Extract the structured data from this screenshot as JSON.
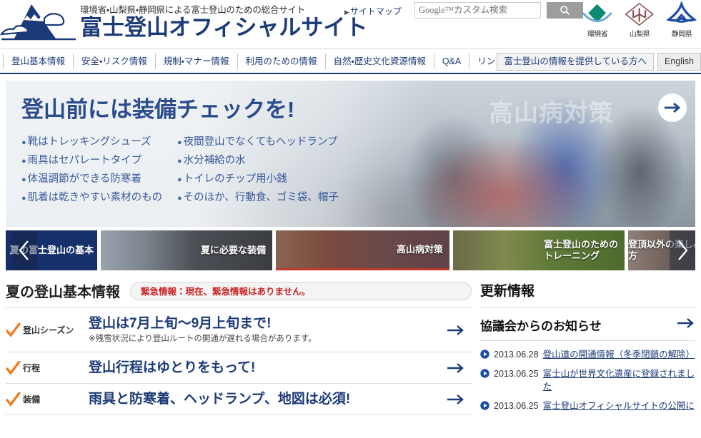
{
  "header": {
    "logo_sub": "環境省・山梨県・静岡県による富士登山のための総合サイト",
    "logo_main": "富士登山オフィシャルサイト",
    "logo_icon": "fuji-mountain-logo",
    "sitemap_label": "サイトマップ",
    "search": {
      "placeholder": "Google™カスタム検索",
      "value": "",
      "button_icon": "search-icon"
    },
    "agencies": [
      {
        "name": "環境省",
        "icon": "ministry-of-environment-logo",
        "color": "#0e8a72"
      },
      {
        "name": "山梨県",
        "icon": "yamanashi-prefecture-logo",
        "color": "#8a4a4a"
      },
      {
        "name": "静岡県",
        "icon": "shizuoka-prefecture-logo",
        "color": "#1b4ea8"
      }
    ]
  },
  "nav": {
    "items": [
      {
        "label": "登山基本情報"
      },
      {
        "label": "安全・リスク情報"
      },
      {
        "label": "規制・マナー情報"
      },
      {
        "label": "利用のための情報"
      },
      {
        "label": "自然・歴史文化資源情報"
      },
      {
        "label": "Q&A"
      },
      {
        "label": "リンク集"
      }
    ],
    "provider_button": "富士登山の情報を提供している方へ",
    "english_button": "English"
  },
  "hero": {
    "title": "登山前には装備チェックを!",
    "ghost_text": "高山病対策",
    "next_icon": "arrow-right-icon",
    "left_items": [
      "靴はトレッキングシューズ",
      "雨具はセパレートタイプ",
      "体温調節ができる防寒着",
      "肌着は乾きやすい素材のもの"
    ],
    "right_items": [
      "夜間登山でなくてもヘッドランプ",
      "水分補給の水",
      "トイレのチップ用小銭",
      "そのほか、行動食、ゴミ袋、帽子"
    ]
  },
  "thumbnails": {
    "prev_icon": "chevron-left-icon",
    "next_icon": "chevron-right-icon",
    "items": [
      {
        "label": "夏の富士登山の基本"
      },
      {
        "label": "夏に必要な装備"
      },
      {
        "label": "高山病対策"
      },
      {
        "label": "富士登山のための\nトレーニング"
      },
      {
        "label": "登頂以外の楽しみ方"
      }
    ]
  },
  "main": {
    "section_title": "夏の登山基本情報",
    "emergency_text": "緊急情報：現在、緊急情報はありません。",
    "rows": [
      {
        "tag": "登山シーズン",
        "headline": "登山は7月上旬〜9月上旬まで!",
        "note": "※残雪状況により登山ルートの開通が遅れる場合があります。",
        "arrow_icon": "arrow-right-icon",
        "check_icon": "orange-check-icon"
      },
      {
        "tag": "行程",
        "headline": "登山行程はゆとりをもって!",
        "note": "",
        "arrow_icon": "arrow-right-icon",
        "check_icon": "orange-check-icon"
      },
      {
        "tag": "装備",
        "headline": "雨具と防寒着、ヘッドランプ、地図は必須!",
        "note": "",
        "arrow_icon": "arrow-right-icon",
        "check_icon": "orange-check-icon"
      }
    ]
  },
  "sidebar": {
    "title": "更新情報",
    "subsection_title": "協議会からのお知らせ",
    "subsection_arrow_icon": "arrow-right-icon",
    "news": [
      {
        "date": "2013.06.28",
        "title": "登山道の開通情報（冬季閉鎖の解除）",
        "bullet_icon": "play-circle-icon"
      },
      {
        "date": "2013.06.25",
        "title": "富士山が世界文化遺産に登録されました",
        "bullet_icon": "play-circle-icon"
      },
      {
        "date": "2013.06.25",
        "title": "富士登山オフィシャルサイトの公開に",
        "bullet_icon": "play-circle-icon"
      }
    ]
  },
  "colors": {
    "brand_navy": "#1b3a78",
    "accent_orange": "#f07c1e",
    "emergency_red": "#cc2222",
    "active_thumb_red": "#c0392b"
  }
}
